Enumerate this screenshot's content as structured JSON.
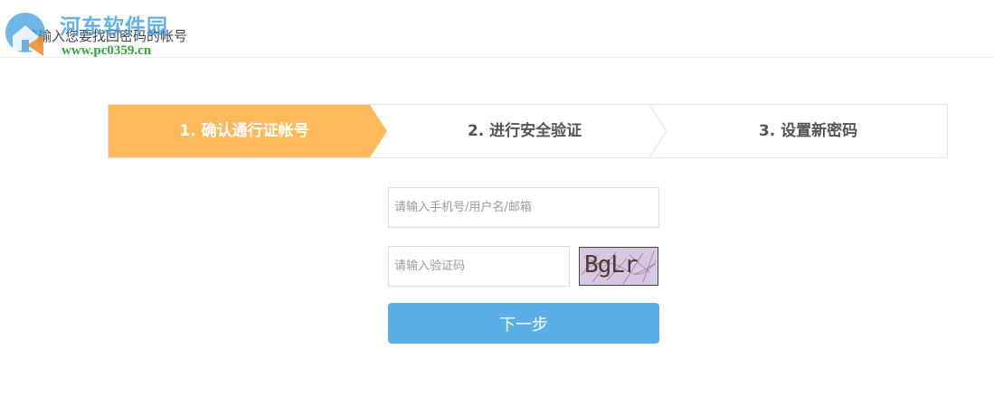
{
  "header": {
    "title": "请输入您要找回密码的帐号",
    "logo_text": "河东软件园",
    "logo_url": "www.pc0359.cn"
  },
  "steps": [
    {
      "label": "1. 确认通行证帐号",
      "active": true
    },
    {
      "label": "2. 进行安全验证",
      "active": false
    },
    {
      "label": "3. 设置新密码",
      "active": false
    }
  ],
  "form": {
    "account_placeholder": "请输入手机号/用户名/邮箱",
    "captcha_placeholder": "请输入验证码",
    "captcha_text": "BgLr",
    "next_label": "下一步"
  },
  "colors": {
    "active_step": "#ffb95a",
    "button": "#5aafe8",
    "logo_blue": "#3e9fe0",
    "logo_green": "#2ea836"
  }
}
